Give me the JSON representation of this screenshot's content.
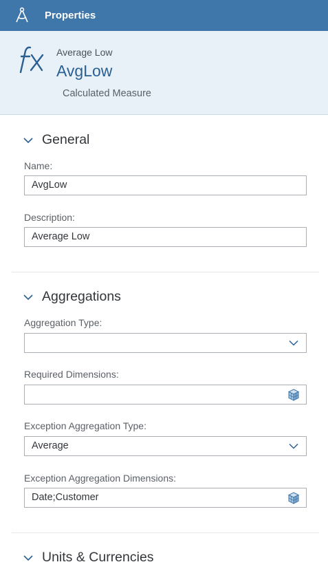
{
  "topbar": {
    "title": "Properties",
    "icon": "compass-icon"
  },
  "header": {
    "icon": "fx-icon",
    "subtitle": "Average Low",
    "title": "AvgLow",
    "type": "Calculated Measure"
  },
  "general": {
    "title": "General",
    "name_label": "Name:",
    "name_value": "AvgLow",
    "description_label": "Description:",
    "description_value": "Average Low"
  },
  "aggregations": {
    "title": "Aggregations",
    "aggregation_type_label": "Aggregation Type:",
    "aggregation_type_value": "",
    "required_dimensions_label": "Required Dimensions:",
    "required_dimensions_value": "",
    "exception_type_label": "Exception Aggregation Type:",
    "exception_type_value": "Average",
    "exception_dimensions_label": "Exception Aggregation Dimensions:",
    "exception_dimensions_value": "Date;Customer"
  },
  "units": {
    "title": "Units & Currencies"
  },
  "colors": {
    "topbar": "#3f77aa",
    "header_bg": "#e8f1f8",
    "accent": "#2a5f92"
  }
}
